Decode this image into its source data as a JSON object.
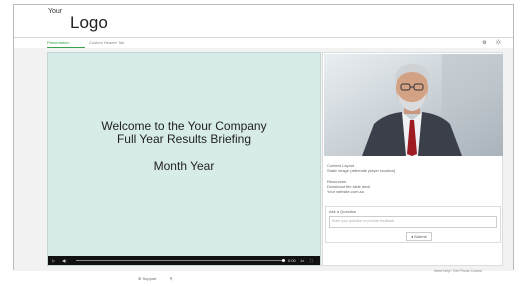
{
  "header": {
    "logo_small": "Your",
    "logo_big": "Logo"
  },
  "tabs": [
    {
      "label": "Presentation"
    },
    {
      "label": "Custom Header Tab"
    }
  ],
  "tools": {
    "settings_icon": "⚙",
    "help_icon": "⓪"
  },
  "slide": {
    "line1": "Welcome to the Your Company",
    "line2": "Full Year Results Briefing",
    "line3": "Month Year"
  },
  "player": {
    "play_icon": "▷",
    "volume_icon": "◀)",
    "time": "0:00",
    "speed": "1x",
    "fullscreen_icon": "⛶",
    "progress": 1.0
  },
  "sidebar": {
    "content_layout_label": "Content Layout",
    "content_layout_text": "Static image (alternate player location)",
    "resources_label": "Resources",
    "resource_1": "Download the slide deck",
    "resource_2": "Your website.com.au",
    "ask_title": "Ask a Question",
    "ask_placeholder": "Enter your question or provide feedback",
    "submit_label": "Submit"
  },
  "footer": {
    "note": "Need help? Get Phone Control",
    "support_label": "Support"
  }
}
